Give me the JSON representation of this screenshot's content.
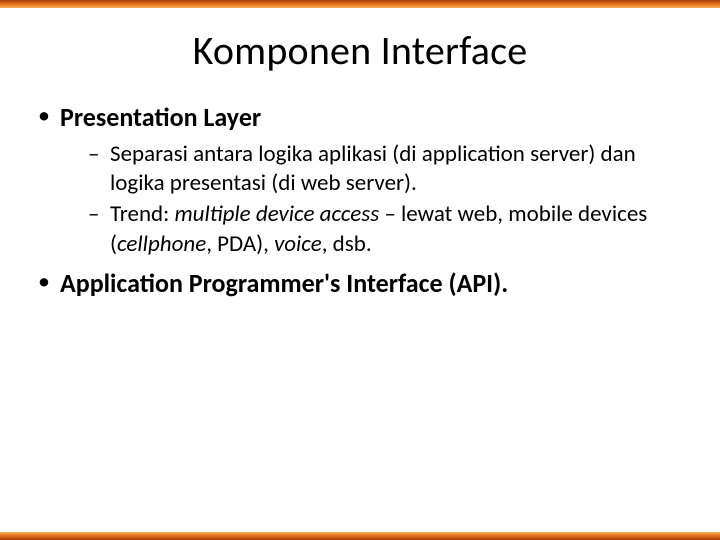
{
  "title": "Komponen Interface",
  "bullets": {
    "b1": {
      "label": "Presentation Layer",
      "sub": {
        "s1": "Separasi antara logika aplikasi (di application server) dan logika presentasi (di web server).",
        "s2_prefix": "Trend: ",
        "s2_em1": "multiple device access",
        "s2_mid1": " – lewat web, mobile devices (",
        "s2_em2": "cellphone",
        "s2_mid2": ", PDA), ",
        "s2_em3": "voice",
        "s2_suffix": ", dsb."
      }
    },
    "b2": {
      "label": "Application Programmer's Interface (API)."
    }
  }
}
